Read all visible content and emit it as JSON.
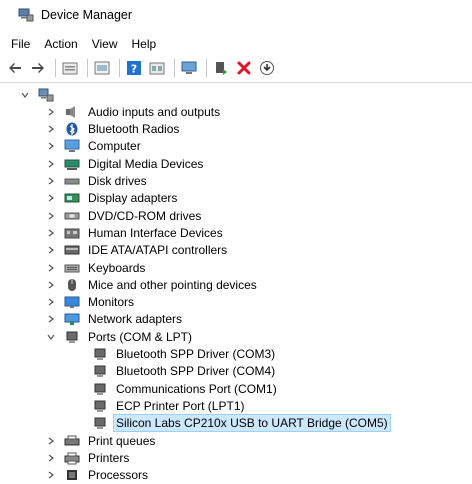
{
  "window": {
    "title": "Device Manager"
  },
  "menu": [
    "File",
    "Action",
    "View",
    "Help"
  ],
  "toolbar_icons": [
    "back-arrow-icon",
    "forward-arrow-icon",
    "properties-icon",
    "show-hidden-icon",
    "help-icon",
    "update-view-icon",
    "monitor-icon",
    "update-driver-icon",
    "uninstall-x-icon",
    "scan-hardware-icon"
  ],
  "tree": {
    "root_icon": "computer-root-icon",
    "categories": [
      {
        "label": "Audio inputs and outputs",
        "icon": "speaker-icon",
        "expanded": false
      },
      {
        "label": "Bluetooth Radios",
        "icon": "bluetooth-icon",
        "expanded": false
      },
      {
        "label": "Computer",
        "icon": "computer-icon",
        "expanded": false
      },
      {
        "label": "Digital Media Devices",
        "icon": "media-device-icon",
        "expanded": false
      },
      {
        "label": "Disk drives",
        "icon": "disk-drive-icon",
        "expanded": false
      },
      {
        "label": "Display adapters",
        "icon": "display-adapter-icon",
        "expanded": false
      },
      {
        "label": "DVD/CD-ROM drives",
        "icon": "dvd-drive-icon",
        "expanded": false
      },
      {
        "label": "Human Interface Devices",
        "icon": "hid-icon",
        "expanded": false
      },
      {
        "label": "IDE ATA/ATAPI controllers",
        "icon": "ide-controller-icon",
        "expanded": false
      },
      {
        "label": "Keyboards",
        "icon": "keyboard-icon",
        "expanded": false
      },
      {
        "label": "Mice and other pointing devices",
        "icon": "mouse-icon",
        "expanded": false
      },
      {
        "label": "Monitors",
        "icon": "monitor-icon",
        "expanded": false
      },
      {
        "label": "Network adapters",
        "icon": "network-adapter-icon",
        "expanded": false
      },
      {
        "label": "Ports (COM & LPT)",
        "icon": "port-icon",
        "expanded": true,
        "children": [
          {
            "label": "Bluetooth SPP Driver (COM3)",
            "icon": "port-icon"
          },
          {
            "label": "Bluetooth SPP Driver (COM4)",
            "icon": "port-icon"
          },
          {
            "label": "Communications Port (COM1)",
            "icon": "port-icon"
          },
          {
            "label": "ECP Printer Port (LPT1)",
            "icon": "port-icon"
          },
          {
            "label": "Silicon Labs CP210x USB to UART Bridge (COM5)",
            "icon": "port-icon",
            "selected": true
          }
        ]
      },
      {
        "label": "Print queues",
        "icon": "print-queue-icon",
        "expanded": false
      },
      {
        "label": "Printers",
        "icon": "printer-icon",
        "expanded": false
      },
      {
        "label": "Processors",
        "icon": "processor-icon",
        "expanded": false
      }
    ]
  },
  "colors": {
    "selection_bg": "#cce8ff",
    "selection_border": "#99d1ff",
    "uninstall_red": "#e81123",
    "accent_blue": "#1e73d2"
  }
}
